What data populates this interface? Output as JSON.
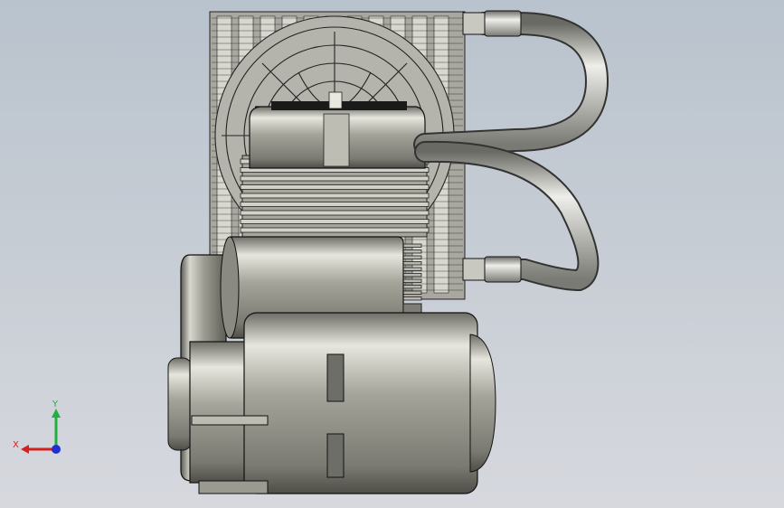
{
  "viewport": {
    "background_top": "#b9c3cd",
    "background_bottom": "#d6d8de",
    "model_color": "#9a9a90",
    "model_highlight": "#e2e2da",
    "edge_color": "#1a1a1a"
  },
  "triad": {
    "x_label": "X",
    "y_label": "Y",
    "x_color": "#d42020",
    "y_color": "#20b040",
    "z_color": "#2030d0"
  },
  "parts": [
    {
      "name": "radiator-grille"
    },
    {
      "name": "cooling-fan"
    },
    {
      "name": "cylinder-head"
    },
    {
      "name": "cylinder-fins"
    },
    {
      "name": "crankcase"
    },
    {
      "name": "electric-motor"
    },
    {
      "name": "cooling-pipes"
    }
  ]
}
